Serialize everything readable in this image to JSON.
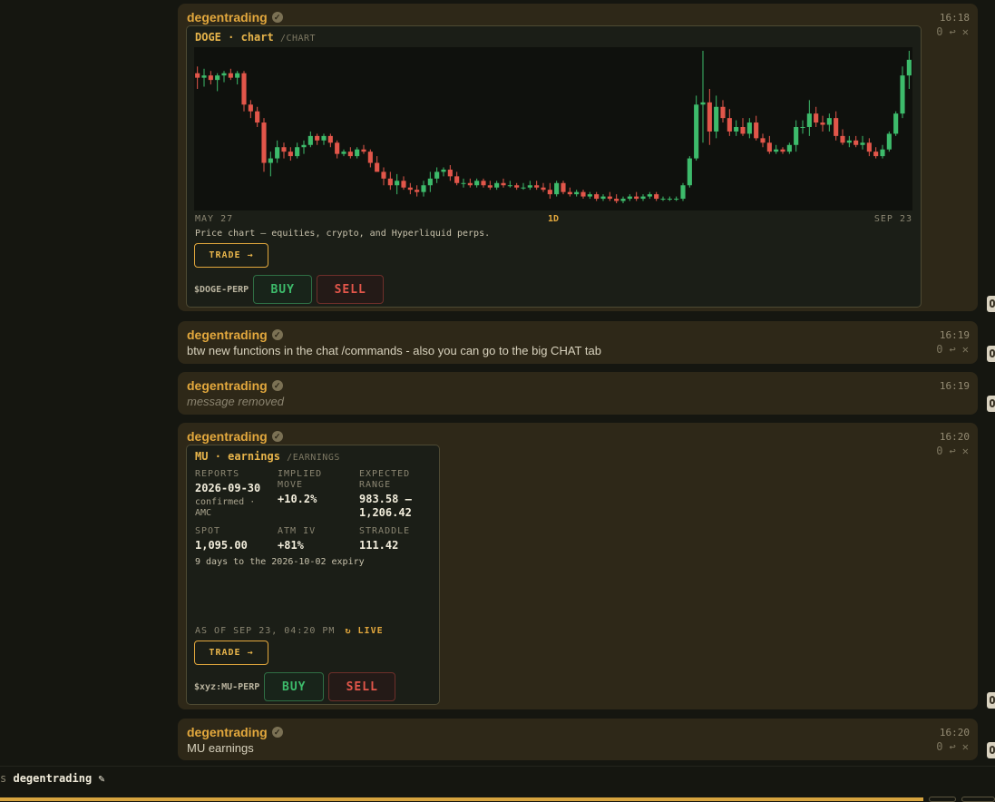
{
  "messages": [
    {
      "author": "degentrading",
      "time": "16:18",
      "reactions": {
        "count": "0"
      },
      "card": {
        "symbol": "DOGE",
        "kind": "chart",
        "command": "/CHART",
        "axis_start": "MAY 27",
        "interval": "1D",
        "axis_end": "SEP 23",
        "description": "Price chart — equities, crypto, and Hyperliquid perps.",
        "trade_label": "TRADE →",
        "perp": "$DOGE-PERP",
        "buy_label": "BUY",
        "sell_label": "SELL"
      }
    },
    {
      "author": "degentrading",
      "time": "16:19",
      "reactions": {
        "count": "0"
      },
      "text": "btw new functions in the chat /commands - also you can go to the big CHAT tab"
    },
    {
      "author": "degentrading",
      "time": "16:19",
      "text": "message removed"
    },
    {
      "author": "degentrading",
      "time": "16:20",
      "reactions": {
        "count": "0"
      },
      "card": {
        "symbol": "MU",
        "kind": "earnings",
        "command": "/EARNINGS",
        "reports_label": "REPORTS",
        "reports_value": "2026-09-30",
        "reports_note": "confirmed · AMC",
        "implied_label": "IMPLIED MOVE",
        "implied_value": "+10.2%",
        "range_label": "EXPECTED RANGE",
        "range_value": "983.58 – 1,206.42",
        "spot_label": "SPOT",
        "spot_value": "1,095.00",
        "iv_label": "ATM IV",
        "iv_value": "+81%",
        "straddle_label": "STRADDLE",
        "straddle_value": "111.42",
        "expiry_note": "9 days to the 2026-10-02 expiry",
        "as_of": "AS OF SEP 23, 04:20 PM",
        "live": "↻ LIVE",
        "trade_label": "TRADE →",
        "perp": "$xyz:MU-PERP",
        "buy_label": "BUY",
        "sell_label": "SELL"
      }
    },
    {
      "author": "degentrading",
      "time": "16:20",
      "reactions": {
        "count": "0"
      },
      "text": "MU earnings"
    }
  ],
  "composer": {
    "prefix": "s",
    "name": "degentrading ✎"
  },
  "icons": {
    "verified": "check-badge-icon",
    "reply": "reply-icon",
    "close": "close-icon"
  },
  "colors": {
    "up": "#3dbb6b",
    "down": "#e2564a",
    "accent": "#e3a83d"
  },
  "chart_data": {
    "type": "candlestick",
    "x_start": "MAY 27",
    "x_end": "SEP 23",
    "interval": "1D",
    "series": [
      {
        "o": 0.32,
        "h": 0.35,
        "l": 0.25,
        "c": 0.3
      },
      {
        "o": 0.3,
        "h": 0.34,
        "l": 0.26,
        "c": 0.31
      },
      {
        "o": 0.31,
        "h": 0.33,
        "l": 0.27,
        "c": 0.29
      },
      {
        "o": 0.29,
        "h": 0.32,
        "l": 0.24,
        "c": 0.31
      },
      {
        "o": 0.31,
        "h": 0.33,
        "l": 0.28,
        "c": 0.32
      },
      {
        "o": 0.32,
        "h": 0.34,
        "l": 0.29,
        "c": 0.3
      },
      {
        "o": 0.3,
        "h": 0.33,
        "l": 0.27,
        "c": 0.32
      },
      {
        "o": 0.32,
        "h": 0.33,
        "l": 0.15,
        "c": 0.18
      },
      {
        "o": 0.18,
        "h": 0.2,
        "l": 0.12,
        "c": 0.15
      },
      {
        "o": 0.15,
        "h": 0.17,
        "l": 0.08,
        "c": 0.1
      },
      {
        "o": 0.1,
        "h": 0.12,
        "l": -0.12,
        "c": -0.08
      },
      {
        "o": -0.08,
        "h": -0.03,
        "l": -0.14,
        "c": -0.06
      },
      {
        "o": -0.06,
        "h": 0.02,
        "l": -0.08,
        "c": -0.01
      },
      {
        "o": -0.01,
        "h": 0.01,
        "l": -0.06,
        "c": -0.03
      },
      {
        "o": -0.03,
        "h": -0.01,
        "l": -0.07,
        "c": -0.05
      },
      {
        "o": -0.05,
        "h": 0.01,
        "l": -0.06,
        "c": -0.01
      },
      {
        "o": -0.01,
        "h": 0.02,
        "l": -0.04,
        "c": 0.0
      },
      {
        "o": 0.0,
        "h": 0.06,
        "l": -0.01,
        "c": 0.04
      },
      {
        "o": 0.04,
        "h": 0.05,
        "l": 0.0,
        "c": 0.02
      },
      {
        "o": 0.02,
        "h": 0.05,
        "l": 0.0,
        "c": 0.04
      },
      {
        "o": 0.04,
        "h": 0.05,
        "l": -0.01,
        "c": 0.01
      },
      {
        "o": 0.01,
        "h": 0.02,
        "l": -0.06,
        "c": -0.04
      },
      {
        "o": -0.04,
        "h": -0.02,
        "l": -0.05,
        "c": -0.03
      },
      {
        "o": -0.03,
        "h": -0.01,
        "l": -0.06,
        "c": -0.05
      },
      {
        "o": -0.05,
        "h": -0.01,
        "l": -0.06,
        "c": -0.02
      },
      {
        "o": -0.02,
        "h": 0.0,
        "l": -0.04,
        "c": -0.03
      },
      {
        "o": -0.03,
        "h": -0.02,
        "l": -0.1,
        "c": -0.08
      },
      {
        "o": -0.08,
        "h": -0.05,
        "l": -0.12,
        "c": -0.12
      },
      {
        "o": -0.12,
        "h": -0.1,
        "l": -0.18,
        "c": -0.15
      },
      {
        "o": -0.15,
        "h": -0.12,
        "l": -0.2,
        "c": -0.18
      },
      {
        "o": -0.18,
        "h": -0.13,
        "l": -0.22,
        "c": -0.16
      },
      {
        "o": -0.16,
        "h": -0.14,
        "l": -0.2,
        "c": -0.19
      },
      {
        "o": -0.19,
        "h": -0.17,
        "l": -0.22,
        "c": -0.2
      },
      {
        "o": -0.2,
        "h": -0.18,
        "l": -0.23,
        "c": -0.21
      },
      {
        "o": -0.21,
        "h": -0.16,
        "l": -0.23,
        "c": -0.18
      },
      {
        "o": -0.18,
        "h": -0.12,
        "l": -0.21,
        "c": -0.15
      },
      {
        "o": -0.15,
        "h": -0.1,
        "l": -0.17,
        "c": -0.12
      },
      {
        "o": -0.12,
        "h": -0.1,
        "l": -0.14,
        "c": -0.11
      },
      {
        "o": -0.11,
        "h": -0.09,
        "l": -0.16,
        "c": -0.14
      },
      {
        "o": -0.14,
        "h": -0.12,
        "l": -0.18,
        "c": -0.17
      },
      {
        "o": -0.17,
        "h": -0.15,
        "l": -0.19,
        "c": -0.17
      },
      {
        "o": -0.17,
        "h": -0.15,
        "l": -0.19,
        "c": -0.18
      },
      {
        "o": -0.18,
        "h": -0.15,
        "l": -0.19,
        "c": -0.16
      },
      {
        "o": -0.16,
        "h": -0.15,
        "l": -0.19,
        "c": -0.18
      },
      {
        "o": -0.18,
        "h": -0.16,
        "l": -0.2,
        "c": -0.19
      },
      {
        "o": -0.19,
        "h": -0.16,
        "l": -0.2,
        "c": -0.17
      },
      {
        "o": -0.17,
        "h": -0.15,
        "l": -0.19,
        "c": -0.18
      },
      {
        "o": -0.18,
        "h": -0.16,
        "l": -0.19,
        "c": -0.18
      },
      {
        "o": -0.18,
        "h": -0.17,
        "l": -0.2,
        "c": -0.19
      },
      {
        "o": -0.19,
        "h": -0.17,
        "l": -0.2,
        "c": -0.19
      },
      {
        "o": -0.19,
        "h": -0.16,
        "l": -0.2,
        "c": -0.18
      },
      {
        "o": -0.18,
        "h": -0.16,
        "l": -0.2,
        "c": -0.19
      },
      {
        "o": -0.19,
        "h": -0.17,
        "l": -0.21,
        "c": -0.2
      },
      {
        "o": -0.2,
        "h": -0.17,
        "l": -0.24,
        "c": -0.22
      },
      {
        "o": -0.22,
        "h": -0.16,
        "l": -0.23,
        "c": -0.17
      },
      {
        "o": -0.17,
        "h": -0.16,
        "l": -0.22,
        "c": -0.21
      },
      {
        "o": -0.21,
        "h": -0.19,
        "l": -0.23,
        "c": -0.22
      },
      {
        "o": -0.22,
        "h": -0.2,
        "l": -0.23,
        "c": -0.21
      },
      {
        "o": -0.21,
        "h": -0.2,
        "l": -0.24,
        "c": -0.23
      },
      {
        "o": -0.23,
        "h": -0.21,
        "l": -0.24,
        "c": -0.22
      },
      {
        "o": -0.22,
        "h": -0.21,
        "l": -0.25,
        "c": -0.24
      },
      {
        "o": -0.24,
        "h": -0.22,
        "l": -0.25,
        "c": -0.23
      },
      {
        "o": -0.23,
        "h": -0.21,
        "l": -0.25,
        "c": -0.24
      },
      {
        "o": -0.24,
        "h": -0.22,
        "l": -0.26,
        "c": -0.25
      },
      {
        "o": -0.25,
        "h": -0.23,
        "l": -0.26,
        "c": -0.24
      },
      {
        "o": -0.24,
        "h": -0.22,
        "l": -0.25,
        "c": -0.23
      },
      {
        "o": -0.23,
        "h": -0.21,
        "l": -0.25,
        "c": -0.24
      },
      {
        "o": -0.24,
        "h": -0.22,
        "l": -0.25,
        "c": -0.23
      },
      {
        "o": -0.23,
        "h": -0.21,
        "l": -0.24,
        "c": -0.22
      },
      {
        "o": -0.22,
        "h": -0.21,
        "l": -0.25,
        "c": -0.24
      },
      {
        "o": -0.24,
        "h": -0.23,
        "l": -0.25,
        "c": -0.24
      },
      {
        "o": -0.24,
        "h": -0.23,
        "l": -0.25,
        "c": -0.24
      },
      {
        "o": -0.24,
        "h": -0.23,
        "l": -0.25,
        "c": -0.24
      },
      {
        "o": -0.24,
        "h": -0.17,
        "l": -0.25,
        "c": -0.18
      },
      {
        "o": -0.18,
        "h": -0.05,
        "l": -0.19,
        "c": -0.06
      },
      {
        "o": -0.06,
        "h": 0.22,
        "l": -0.07,
        "c": 0.18
      },
      {
        "o": 0.18,
        "h": 0.42,
        "l": 0.01,
        "c": 0.19
      },
      {
        "o": 0.19,
        "h": 0.25,
        "l": 0.0,
        "c": 0.06
      },
      {
        "o": 0.06,
        "h": 0.22,
        "l": 0.03,
        "c": 0.17
      },
      {
        "o": 0.17,
        "h": 0.2,
        "l": 0.1,
        "c": 0.12
      },
      {
        "o": 0.12,
        "h": 0.16,
        "l": 0.04,
        "c": 0.06
      },
      {
        "o": 0.06,
        "h": 0.11,
        "l": 0.04,
        "c": 0.08
      },
      {
        "o": 0.08,
        "h": 0.12,
        "l": 0.04,
        "c": 0.05
      },
      {
        "o": 0.05,
        "h": 0.12,
        "l": 0.03,
        "c": 0.1
      },
      {
        "o": 0.1,
        "h": 0.13,
        "l": 0.02,
        "c": 0.03
      },
      {
        "o": 0.03,
        "h": 0.05,
        "l": -0.01,
        "c": 0.01
      },
      {
        "o": 0.01,
        "h": 0.04,
        "l": -0.04,
        "c": -0.03
      },
      {
        "o": -0.03,
        "h": 0.0,
        "l": -0.04,
        "c": -0.02
      },
      {
        "o": -0.02,
        "h": -0.01,
        "l": -0.04,
        "c": -0.03
      },
      {
        "o": -0.03,
        "h": 0.01,
        "l": -0.04,
        "c": 0.0
      },
      {
        "o": 0.0,
        "h": 0.11,
        "l": -0.03,
        "c": 0.08
      },
      {
        "o": 0.08,
        "h": 0.11,
        "l": 0.05,
        "c": 0.08
      },
      {
        "o": 0.08,
        "h": 0.2,
        "l": 0.04,
        "c": 0.14
      },
      {
        "o": 0.14,
        "h": 0.17,
        "l": 0.08,
        "c": 0.1
      },
      {
        "o": 0.1,
        "h": 0.13,
        "l": 0.06,
        "c": 0.09
      },
      {
        "o": 0.09,
        "h": 0.14,
        "l": 0.06,
        "c": 0.12
      },
      {
        "o": 0.12,
        "h": 0.15,
        "l": 0.02,
        "c": 0.04
      },
      {
        "o": 0.04,
        "h": 0.07,
        "l": 0.0,
        "c": 0.01
      },
      {
        "o": 0.01,
        "h": 0.04,
        "l": -0.01,
        "c": 0.02
      },
      {
        "o": 0.02,
        "h": 0.04,
        "l": -0.01,
        "c": 0.0
      },
      {
        "o": 0.0,
        "h": 0.04,
        "l": -0.02,
        "c": 0.01
      },
      {
        "o": 0.01,
        "h": 0.03,
        "l": -0.05,
        "c": -0.03
      },
      {
        "o": -0.03,
        "h": -0.01,
        "l": -0.06,
        "c": -0.05
      },
      {
        "o": -0.05,
        "h": 0.0,
        "l": -0.06,
        "c": -0.02
      },
      {
        "o": -0.02,
        "h": 0.06,
        "l": -0.03,
        "c": 0.05
      },
      {
        "o": 0.05,
        "h": 0.15,
        "l": 0.04,
        "c": 0.14
      },
      {
        "o": 0.14,
        "h": 0.35,
        "l": 0.12,
        "c": 0.31
      },
      {
        "o": 0.31,
        "h": 0.42,
        "l": 0.25,
        "c": 0.38
      }
    ]
  }
}
